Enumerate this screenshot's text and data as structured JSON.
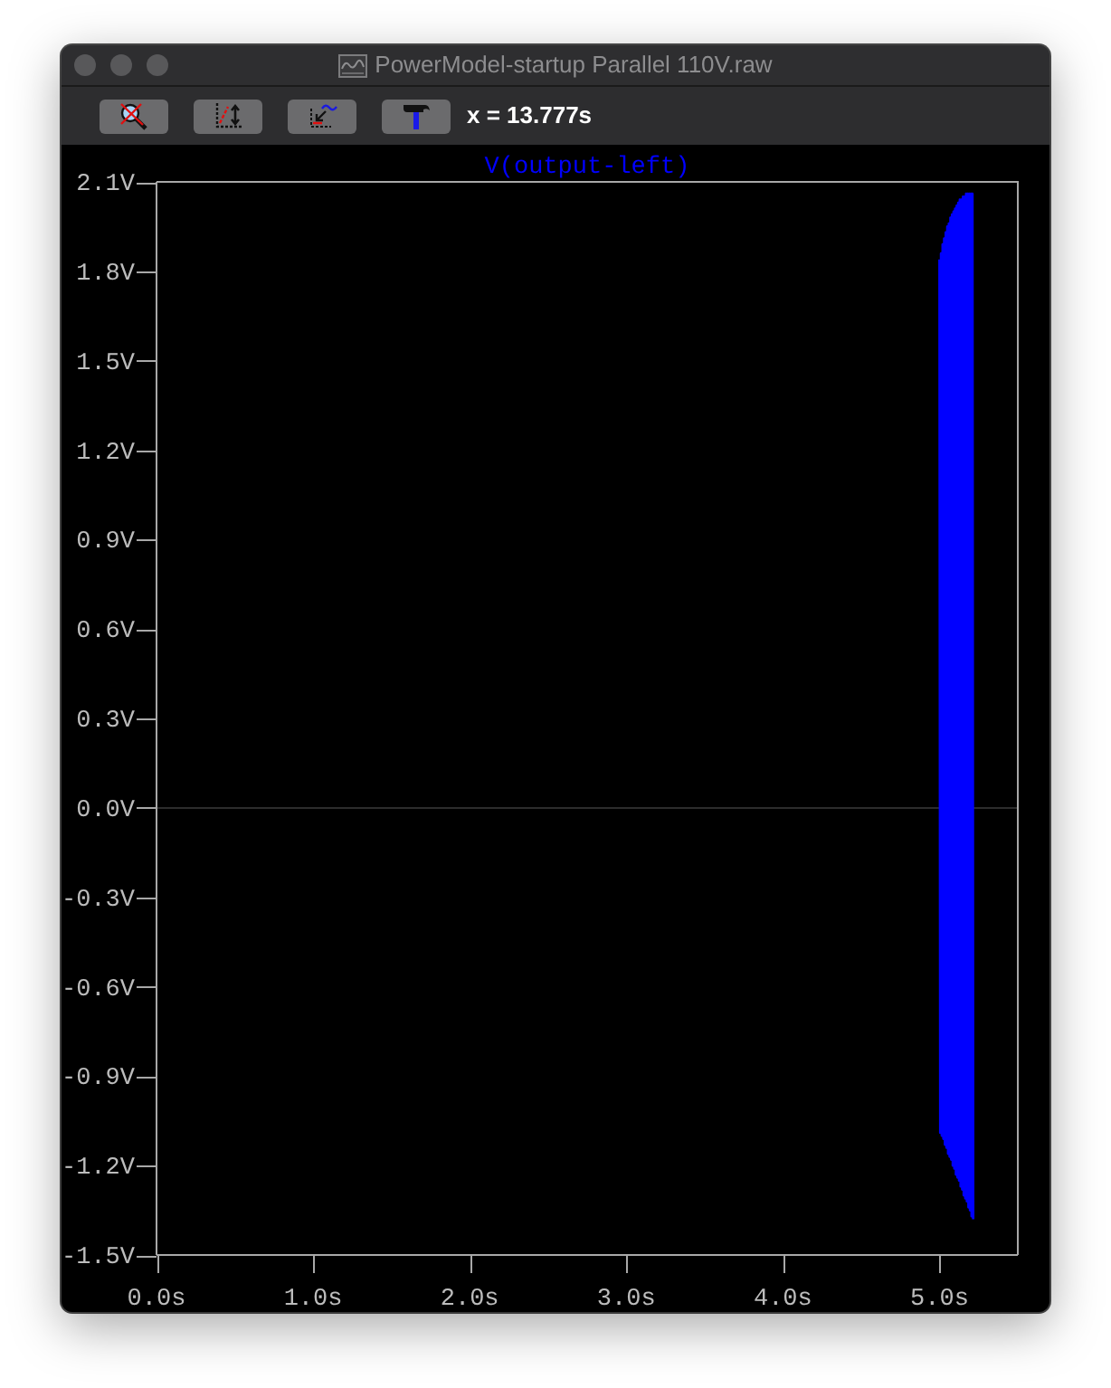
{
  "window": {
    "title": "PowerModel-startup Parallel 110V.raw"
  },
  "toolbar": {
    "cursor_readout": "x = 13.777s"
  },
  "plot": {
    "chart_data": {
      "type": "line",
      "x": [
        5,
        5.005,
        5.01,
        5.015,
        5.02,
        5.025,
        5.03,
        5.035,
        5.04,
        5.045,
        5.05,
        5.055,
        5.06,
        5.065,
        5.07,
        5.075,
        5.08,
        5.085,
        5.09,
        5.095,
        5.1,
        5.105,
        5.11,
        5.115,
        5.12,
        5.125,
        5.13,
        5.135,
        5.14,
        5.145,
        5.15,
        5.155,
        5.16,
        5.165,
        5.17,
        5.175,
        5.18,
        5.185,
        5.19,
        5.195,
        5.2,
        5.205,
        5.21,
        5.215
      ],
      "series": [
        {
          "name": "V(output-left)",
          "color": "#0000ff",
          "values": [
            1.84,
            -1.09,
            1.86,
            -1.1,
            1.89,
            -1.11,
            1.91,
            -1.13,
            1.93,
            -1.14,
            1.95,
            -1.16,
            1.96,
            -1.17,
            1.98,
            -1.18,
            1.99,
            -1.2,
            2.0,
            -1.21,
            2.01,
            -1.23,
            2.02,
            -1.24,
            2.03,
            -1.25,
            2.04,
            -1.27,
            2.04,
            -1.28,
            2.05,
            -1.3,
            2.05,
            -1.31,
            2.06,
            -1.32,
            2.06,
            -1.34,
            2.06,
            -1.35,
            2.06,
            -1.37,
            2.06,
            -1.38
          ]
        }
      ],
      "xlim": [
        0,
        5.5
      ],
      "ylim": [
        -1.5,
        2.1
      ],
      "xticks": [
        {
          "value": 0,
          "label": "0.0s"
        },
        {
          "value": 1,
          "label": "1.0s"
        },
        {
          "value": 2,
          "label": "2.0s"
        },
        {
          "value": 3,
          "label": "3.0s"
        },
        {
          "value": 4,
          "label": "4.0s"
        },
        {
          "value": 5,
          "label": "5.0s"
        }
      ],
      "yticks": [
        {
          "value": 2.1,
          "label": "2.1V"
        },
        {
          "value": 1.8,
          "label": "1.8V"
        },
        {
          "value": 1.5,
          "label": "1.5V"
        },
        {
          "value": 1.2,
          "label": "1.2V"
        },
        {
          "value": 0.9,
          "label": "0.9V"
        },
        {
          "value": 0.6,
          "label": "0.6V"
        },
        {
          "value": 0.3,
          "label": "0.3V"
        },
        {
          "value": 0,
          "label": "0.0V"
        },
        {
          "value": -0.3,
          "label": "-0.3V"
        },
        {
          "value": -0.6,
          "label": "-0.6V"
        },
        {
          "value": -0.9,
          "label": "-0.9V"
        },
        {
          "value": -1.2,
          "label": "-1.2V"
        },
        {
          "value": -1.5,
          "label": "-1.5V"
        }
      ]
    }
  }
}
